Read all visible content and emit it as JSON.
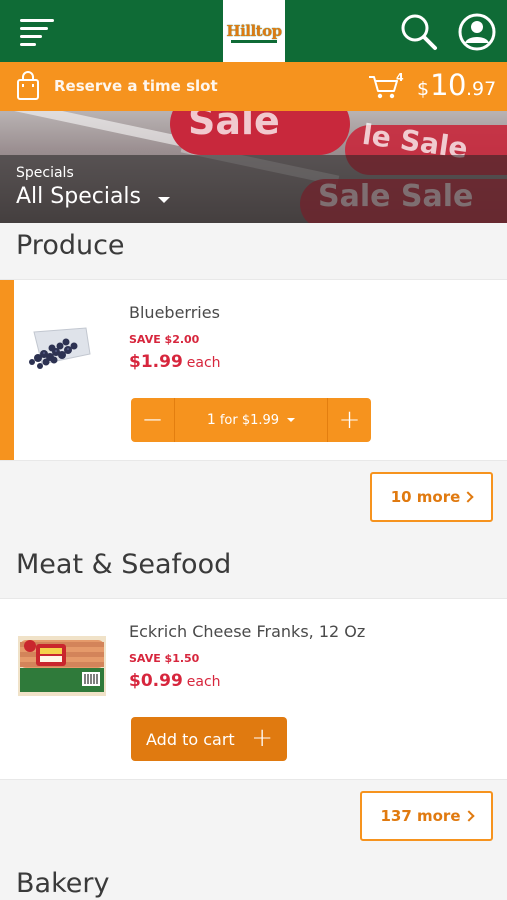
{
  "header": {
    "logo_text": "Hilltop",
    "menu_icon": "hamburger-menu-icon",
    "search_icon": "search-icon",
    "account_icon": "account-icon",
    "bar_color": "#0f6b36"
  },
  "reserve_bar": {
    "reserve_label": "Reserve a time slot",
    "cart_count": "4",
    "cart_currency": "$",
    "cart_dollars": "10",
    "cart_cents": ".97",
    "bar_color": "#f6931e"
  },
  "banner": {
    "specials_label": "Specials",
    "specials_selected": "All Specials"
  },
  "sections": [
    {
      "title": "Produce",
      "product": {
        "name": "Blueberries",
        "save": "SAVE $2.00",
        "price": "$1.99",
        "unit": "each",
        "qty_prefix": "1",
        "qty_suffix": "for $1.99",
        "minus": "−",
        "plus": "+"
      },
      "more_label": "10 more"
    },
    {
      "title": "Meat & Seafood",
      "product": {
        "name": "Eckrich Cheese Franks, 12 Oz",
        "save": "SAVE $1.50",
        "price": "$0.99",
        "unit": "each",
        "add_label": "Add to cart",
        "plus": "+"
      },
      "more_label": "137 more"
    },
    {
      "title": "Bakery"
    }
  ],
  "colors": {
    "accent_orange": "#f6931e",
    "price_red": "#d7263d",
    "brand_green": "#0f6b36"
  }
}
